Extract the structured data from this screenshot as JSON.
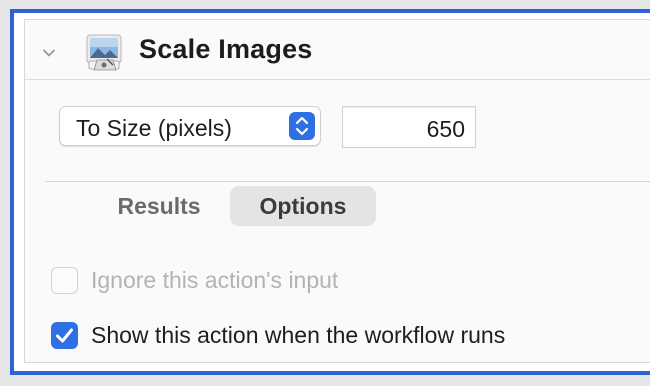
{
  "action": {
    "title": "Scale Images",
    "icon": "preview-image-icon",
    "disclosure_icon": "chevron-down-icon"
  },
  "scale": {
    "mode_label": "To Size (pixels)",
    "mode_icon": "stepper-arrows-icon",
    "value": "650"
  },
  "tabs": [
    {
      "label": "Results",
      "selected": false
    },
    {
      "label": "Options",
      "selected": true
    }
  ],
  "options": {
    "ignore_input": {
      "label": "Ignore this action's input",
      "checked": false,
      "enabled": false
    },
    "show_action": {
      "label": "Show this action when the workflow runs",
      "checked": true,
      "enabled": true
    }
  },
  "colors": {
    "frame_border": "#2f62d6",
    "accent": "#2f6fe4",
    "selected_tab_bg": "#e4e4e4"
  }
}
